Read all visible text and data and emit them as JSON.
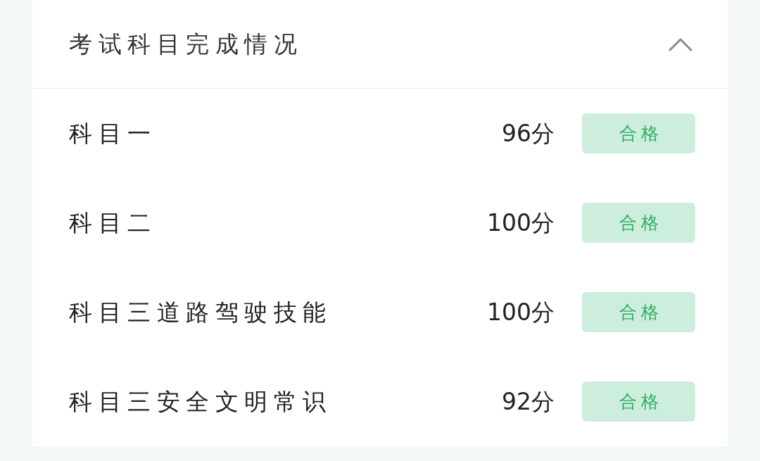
{
  "section": {
    "title": "考试科目完成情况",
    "expanded": true,
    "subjects": [
      {
        "name": "科目一",
        "score": "96分",
        "result": "合格"
      },
      {
        "name": "科目二",
        "score": "100分",
        "result": "合格"
      },
      {
        "name": "科目三道路驾驶技能",
        "score": "100分",
        "result": "合格"
      },
      {
        "name": "科目三安全文明常识",
        "score": "92分",
        "result": "合格"
      }
    ]
  }
}
